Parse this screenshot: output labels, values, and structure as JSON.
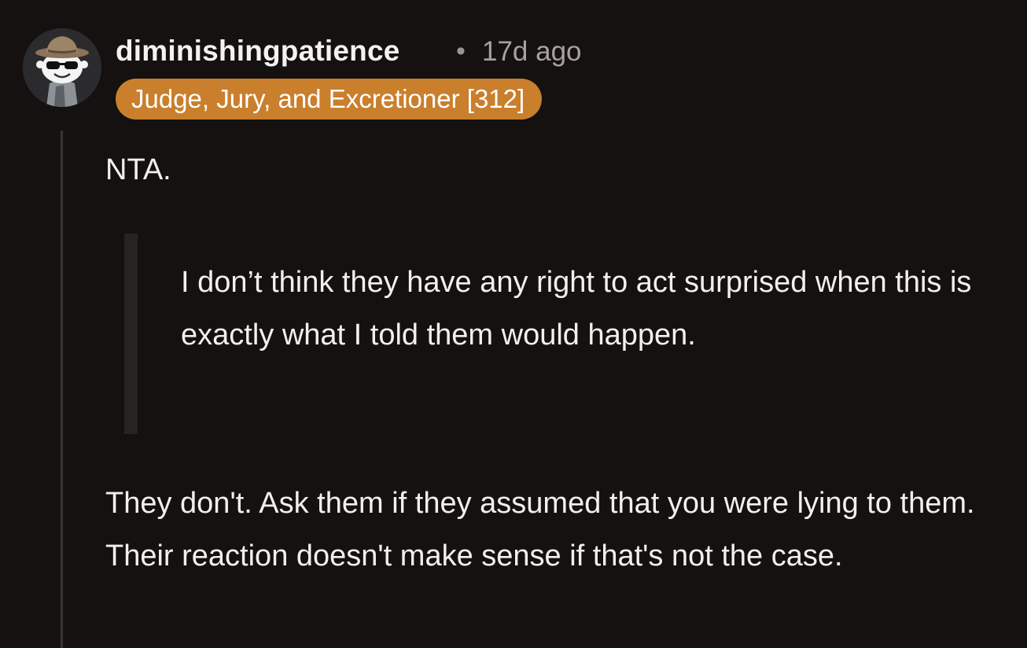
{
  "comment": {
    "author": "diminishingpatience",
    "separator": "•",
    "timestamp": "17d ago",
    "flair": "Judge, Jury, and Excretioner [312]",
    "flair_color": "#c97f2c",
    "avatar_icon": "snoo-cowboy-hat-sunglasses-avatar",
    "paragraphs": {
      "first": "NTA.",
      "quote": "I don’t think they have any right to act surprised when this is exactly what I told them would happen.",
      "last": "They don't. Ask them if they assumed that you were lying to them. Their reaction doesn't make sense if that's not the case."
    }
  },
  "theme": {
    "background": "#141110",
    "text": "#f2f0ee",
    "muted": "#a8a29e"
  }
}
